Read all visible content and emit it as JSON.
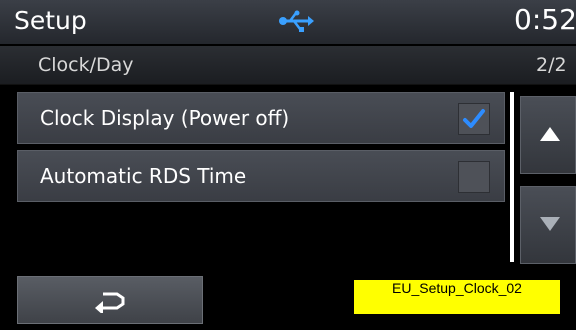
{
  "status": {
    "title": "Setup",
    "icon": "usb-icon",
    "time": "0:52"
  },
  "subheader": {
    "title": "Clock/Day",
    "page": "2/2"
  },
  "items": [
    {
      "label": "Clock Display (Power off)",
      "checked": true
    },
    {
      "label": "Automatic RDS Time",
      "checked": false
    }
  ],
  "controls": {
    "scroll_up_icon": "up-triangle-icon",
    "scroll_down_icon": "down-triangle-icon",
    "back_icon": "return-arrow-icon"
  },
  "caption": "EU_Setup_Clock_02",
  "colors": {
    "check": "#2d8cff",
    "caption_bg": "#ffff00"
  }
}
